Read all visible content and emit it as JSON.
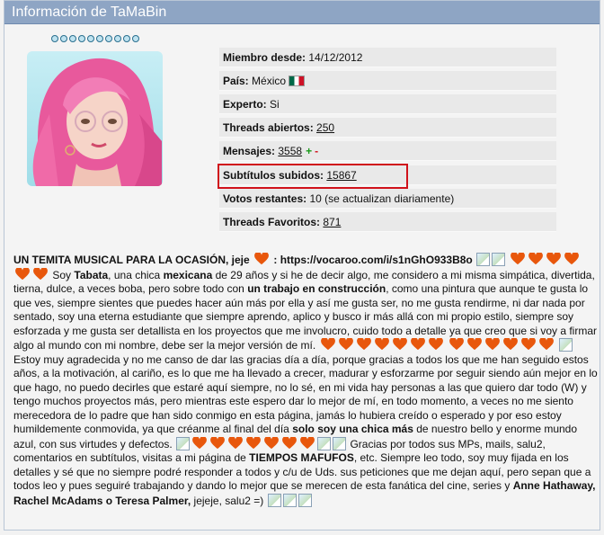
{
  "header": {
    "title": "Información de TaMaBin"
  },
  "rank_dots": 10,
  "profile": {
    "miembro_label": "Miembro desde:",
    "miembro_value": "14/12/2012",
    "pais_label": "País:",
    "pais_value": "México",
    "experto_label": "Experto:",
    "experto_value": "Si",
    "threads_label": "Threads abiertos:",
    "threads_value": "250",
    "mensajes_label": "Mensajes:",
    "mensajes_value": "3558",
    "plus": "+",
    "minus": "-",
    "subtitulos_label": "Subtítulos subidos:",
    "subtitulos_value": "15867",
    "votos_label": "Votos restantes:",
    "votos_value": "10 (se actualizan diariamente)",
    "favoritos_label": "Threads Favoritos:",
    "favoritos_value": "871"
  },
  "bio": {
    "p1": "UN TEMITA MUSICAL PARA LA OCASIÓN, jeje",
    "p2": ": https://vocaroo.com/i/s1nGhO933B8o",
    "p3": "Soy",
    "p4": "Tabata",
    "p5": ", una chica",
    "p6": "mexicana",
    "p7": "de 29 años y si he de decir algo, me considero a mi misma simpática, divertida, tierna, dulce, a veces boba, pero sobre todo con",
    "p8": "un trabajo en construcción",
    "p9": ", como una pintura que aunque te gusta lo que ves, siempre sientes que puedes hacer aún más por ella y así me gusta ser, no me gusta rendirme, ni dar nada por sentado, soy una eterna estudiante que siempre aprendo, aplico y busco ir más allá con mi propio estilo, siempre soy esforzada y me gusta ser detallista en los proyectos que me involucro, cuido todo a detalle ya que creo que si voy a firmar algo al mundo con mi nombre, debe ser la mejor versión de mí.",
    "p10": "Estoy muy agradecida y no me canso de dar las gracias día a día, porque gracias a todos los que me han seguido estos años, a la motivación, al cariño, es lo que me ha llevado a crecer, madurar y esforzarme por seguir siendo aún mejor en lo que hago, no puedo decirles que estaré aquí siempre, no lo sé, en mi vida hay personas a las que quiero dar todo (W) y tengo muchos proyectos más, pero mientras este espero dar lo mejor de mí, en todo momento, a veces no me siento merecedora de lo padre que han sido conmigo en esta página, jamás lo hubiera creído o esperado y por eso estoy humildemente conmovida, ya que créanme al final del día",
    "p11": "solo soy una chica más",
    "p12": "de nuestro bello y enorme mundo azul, con sus virtudes y defectos.",
    "p13": "Gracias por todos sus MPs, mails, salu2, comentarios en subtítulos, visitas a mi página de",
    "p14": "TIEMPOS MAFUFOS",
    "p15": ", etc. Siempre leo todo, soy muy fijada en los detalles y sé que no siempre podré responder a todos y c/u de Uds. sus peticiones que me dejan aquí, pero sepan que a todos leo y pues seguiré trabajando y dando lo mejor que se merecen de esta fanática del cine, series y",
    "p16": "Anne Hathaway, Rachel McAdams o Teresa Palmer,",
    "p17": "jejeje, salu2 =)",
    "estoy_alt": "Estoy"
  }
}
